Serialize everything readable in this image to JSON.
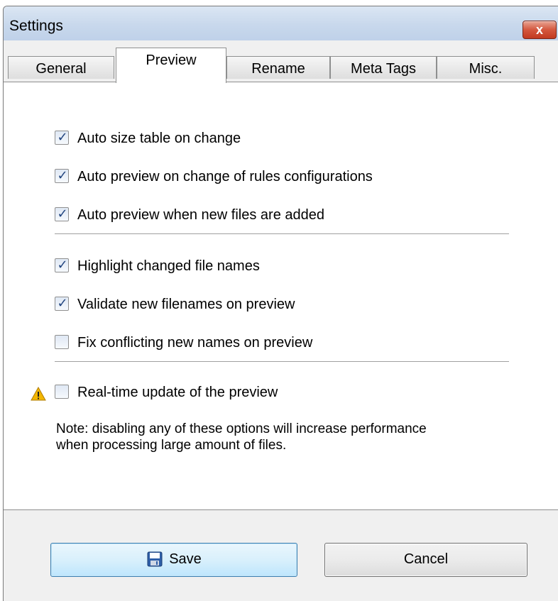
{
  "window": {
    "title": "Settings",
    "close_label": "x"
  },
  "tabs": [
    {
      "label": "General",
      "active": false
    },
    {
      "label": "Preview",
      "active": true
    },
    {
      "label": "Rename",
      "active": false
    },
    {
      "label": "Meta Tags",
      "active": false
    },
    {
      "label": "Misc.",
      "active": false
    }
  ],
  "options": {
    "group1": [
      {
        "label": "Auto size table on change",
        "checked": true
      },
      {
        "label": "Auto preview on change of rules configurations",
        "checked": true
      },
      {
        "label": "Auto preview when new files are added",
        "checked": true
      }
    ],
    "group2": [
      {
        "label": "Highlight changed file names",
        "checked": true
      },
      {
        "label": "Validate new filenames on preview",
        "checked": true
      },
      {
        "label": "Fix conflicting new names on preview",
        "checked": false
      }
    ],
    "realtime": {
      "label": "Real-time update of the preview",
      "checked": false,
      "icon": "warning-icon"
    }
  },
  "note": {
    "line1": "Note: disabling any of these options will increase performance",
    "line2": "when processing large amount of files."
  },
  "buttons": {
    "save_label": "Save",
    "save_icon": "floppy-disk-icon",
    "cancel_label": "Cancel"
  },
  "colors": {
    "warning": "#f2b600",
    "check": "#21447f",
    "close_button": "#c23a20",
    "save_border": "#3c7fb1"
  }
}
